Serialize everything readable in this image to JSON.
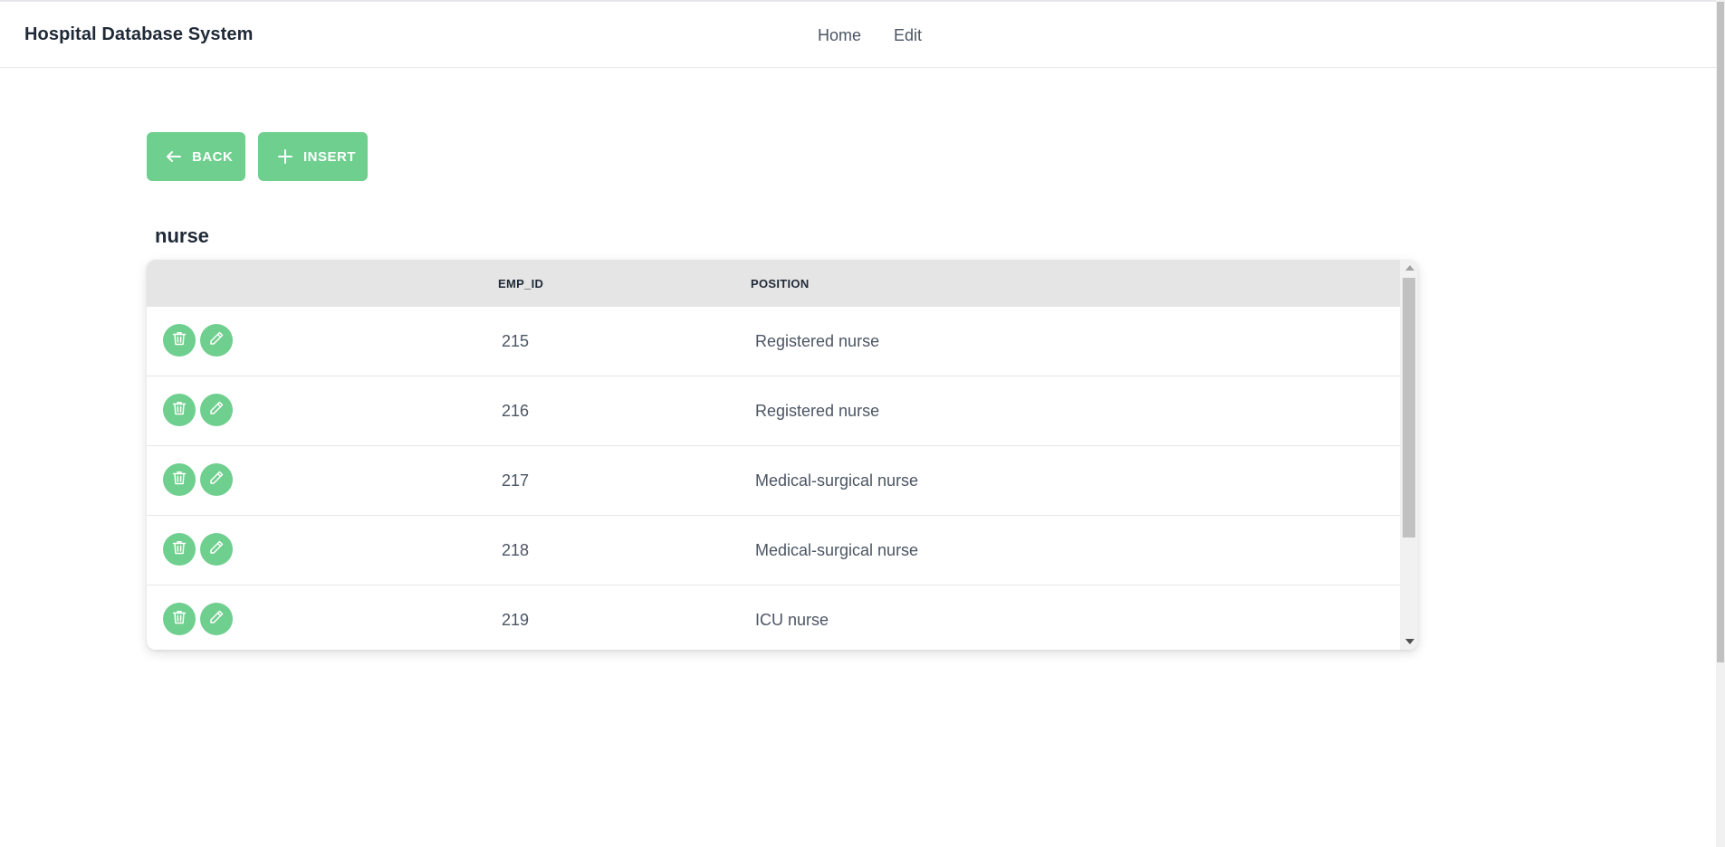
{
  "app": {
    "brand": "Hospital Database System"
  },
  "nav": {
    "links": [
      "Home",
      "Edit"
    ]
  },
  "actions": {
    "back_label": "BACK",
    "insert_label": "INSERT"
  },
  "table": {
    "title": "nurse",
    "columns": [
      "",
      "EMP_ID",
      "POSITION"
    ],
    "rows": [
      {
        "emp_id": "215",
        "position": "Registered nurse"
      },
      {
        "emp_id": "216",
        "position": "Registered nurse"
      },
      {
        "emp_id": "217",
        "position": "Medical-surgical nurse"
      },
      {
        "emp_id": "218",
        "position": "Medical-surgical nurse"
      },
      {
        "emp_id": "219",
        "position": "ICU nurse"
      }
    ]
  },
  "icons": {
    "back": "arrow-left-icon",
    "insert": "plus-icon",
    "delete": "trash-icon",
    "edit": "pencil-icon"
  },
  "colors": {
    "accent": "#6fcf8e",
    "header_bg": "#e5e5e5"
  }
}
